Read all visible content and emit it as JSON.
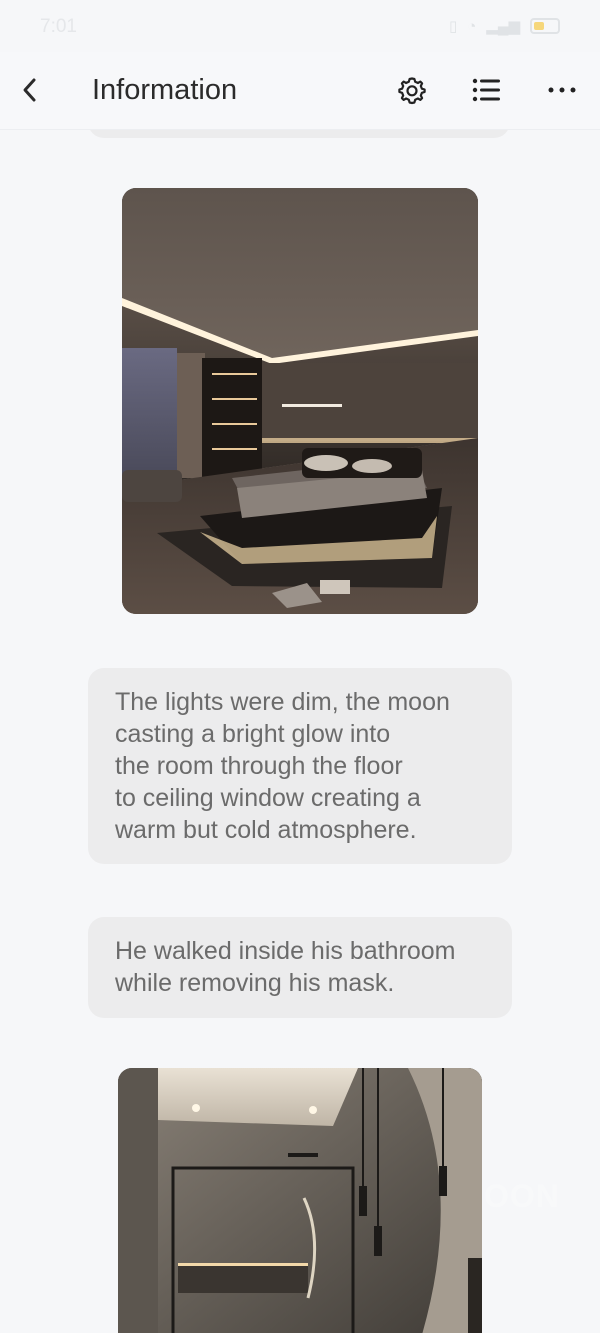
{
  "status_bar": {
    "time": "7:01",
    "icons": [
      "vibrate-icon",
      "alarm-icon",
      "wifi-icon",
      "signal-icon",
      "battery-icon"
    ]
  },
  "app_bar": {
    "title": "Information",
    "back_icon": "back-arrow-icon",
    "actions": [
      "settings-icon",
      "list-icon",
      "more-icon"
    ]
  },
  "messages": [
    {
      "type": "image",
      "description_icon": "bedroom-image"
    },
    {
      "type": "text",
      "lines": [
        "The lights were dim, the moon",
        "casting a bright glow into",
        "the room through the floor",
        "to ceiling window creating a",
        "warm but cold atmosphere."
      ]
    },
    {
      "type": "text",
      "lines": [
        "He walked inside his bathroom",
        "while removing his mask."
      ]
    },
    {
      "type": "image",
      "description_icon": "bathroom-image"
    }
  ],
  "watermark": "OON",
  "colors": {
    "background": "#f6f7f9",
    "bubble": "#ececed",
    "text": "#6b6b6b",
    "title": "#2b2b2b"
  }
}
